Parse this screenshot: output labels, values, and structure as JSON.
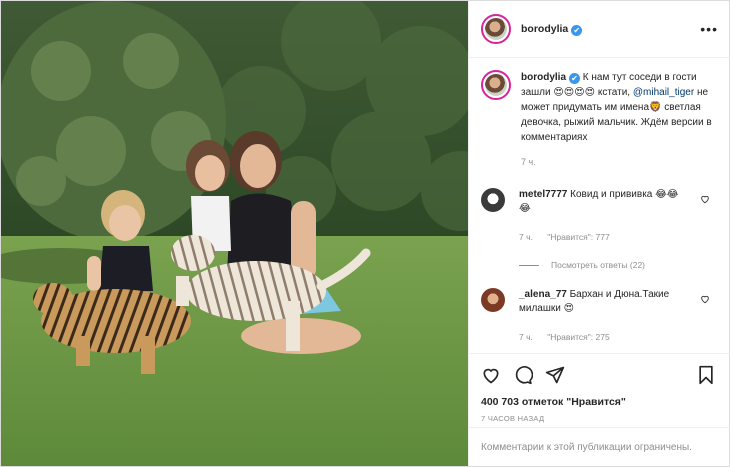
{
  "post": {
    "username": "borodylia",
    "verified_mark": "✔",
    "more_icon": "more-horizontal-icon"
  },
  "caption": {
    "username": "borodylia",
    "text_part1": " К нам тут соседи в гости зашли 😍😍😍😍 кстати, ",
    "mention": "@mihail_tiger",
    "text_part2": " не может придумать им имена🦁 светлая девочка, рыжий мальчик. Ждём версии в комментариях",
    "time": "7 ч."
  },
  "comments": [
    {
      "username": "metel7777",
      "text": " Ковид и прививка 😂😂😂",
      "time": "7 ч.",
      "likes_label": "\"Нравится\": 777",
      "replies_label": "Посмотреть ответы (22)"
    },
    {
      "username": "_alena_77",
      "text": " Бархан и Дюна.Такие милашки 😍",
      "time": "7 ч.",
      "likes_label": "\"Нравится\": 275"
    }
  ],
  "stats": {
    "likes": "400 703 отметок \"Нравится\"",
    "posted": "7 ЧАСОВ НАЗАД"
  },
  "footer": {
    "limited": "Комментарии к этой публикации ограничены."
  }
}
